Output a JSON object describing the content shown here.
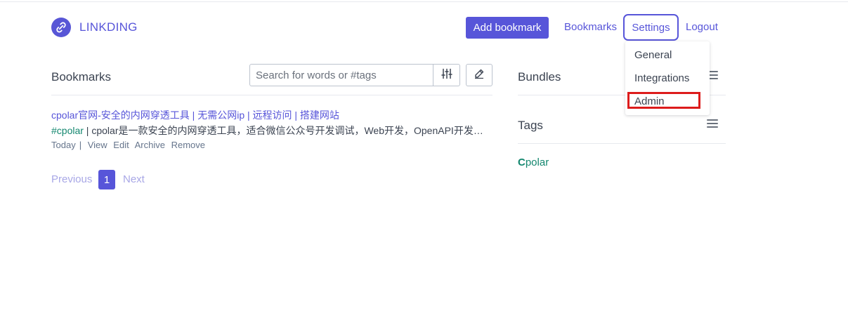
{
  "header": {
    "brand": "LINKDING",
    "add_bookmark": "Add bookmark",
    "nav": {
      "bookmarks": "Bookmarks",
      "settings": "Settings",
      "logout": "Logout"
    }
  },
  "settings_menu": {
    "items": [
      "General",
      "Integrations",
      "Admin"
    ],
    "highlighted": "Admin"
  },
  "bookmarks": {
    "title": "Bookmarks",
    "search_placeholder": "Search for words or #tags",
    "items": [
      {
        "title": "cpolar官网-安全的内网穿透工具 | 无需公网ip | 远程访问 | 搭建网站",
        "tag": "#cpolar",
        "separator": " | ",
        "description": "cpolar是一款安全的内网穿透工具，适合微信公众号开发调试，Web开发，OpenAPI开发…",
        "date": "Today",
        "actions": [
          "View",
          "Edit",
          "Archive",
          "Remove"
        ]
      }
    ],
    "pagination": {
      "previous": "Previous",
      "current": "1",
      "next": "Next"
    }
  },
  "sidebar": {
    "bundles_title": "Bundles",
    "tags_title": "Tags",
    "tags": [
      {
        "first": "C",
        "rest": "polar"
      }
    ]
  },
  "colors": {
    "accent": "#5755d9",
    "tag": "#14876f",
    "highlight_box": "#dd1c1c"
  },
  "icons": [
    "link-logo-icon",
    "sliders-icon",
    "pencil-icon",
    "menu-icon"
  ]
}
